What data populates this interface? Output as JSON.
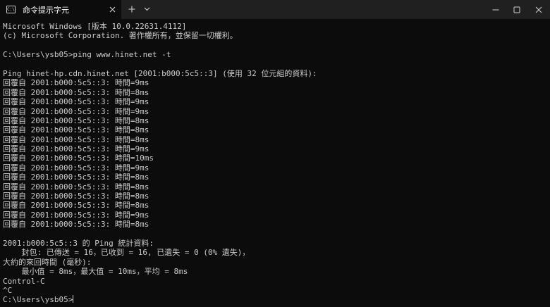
{
  "tab": {
    "title": "命令提示字元",
    "icon": "terminal-icon",
    "icon_glyph": "C:\\"
  },
  "titlebar_icons": {
    "close_tab": "close-icon",
    "new_tab": "plus-icon",
    "dropdown": "chevron-down-icon",
    "minimize": "minimize-icon",
    "maximize": "maximize-icon",
    "close_window": "close-icon"
  },
  "terminal": {
    "lines": [
      "Microsoft Windows [版本 10.0.22631.4112]",
      "(c) Microsoft Corporation. 著作權所有，並保留一切權利。",
      "",
      "C:\\Users\\ysb05>ping www.hinet.net -t",
      "",
      "Ping hinet-hp.cdn.hinet.net [2001:b000:5c5::3] (使用 32 位元組的資料):",
      "回覆自 2001:b000:5c5::3: 時間=9ms",
      "回覆自 2001:b000:5c5::3: 時間=8ms",
      "回覆自 2001:b000:5c5::3: 時間=9ms",
      "回覆自 2001:b000:5c5::3: 時間=9ms",
      "回覆自 2001:b000:5c5::3: 時間=8ms",
      "回覆自 2001:b000:5c5::3: 時間=8ms",
      "回覆自 2001:b000:5c5::3: 時間=8ms",
      "回覆自 2001:b000:5c5::3: 時間=9ms",
      "回覆自 2001:b000:5c5::3: 時間=10ms",
      "回覆自 2001:b000:5c5::3: 時間=9ms",
      "回覆自 2001:b000:5c5::3: 時間=8ms",
      "回覆自 2001:b000:5c5::3: 時間=8ms",
      "回覆自 2001:b000:5c5::3: 時間=8ms",
      "回覆自 2001:b000:5c5::3: 時間=8ms",
      "回覆自 2001:b000:5c5::3: 時間=9ms",
      "回覆自 2001:b000:5c5::3: 時間=8ms",
      "",
      "2001:b000:5c5::3 的 Ping 統計資料:",
      "    封包: 已傳送 = 16，已收到 = 16, 已遺失 = 0 (0% 遺失)，",
      "大約的來回時間 (毫秒):",
      "    最小值 = 8ms，最大值 = 10ms，平均 = 8ms",
      "Control-C",
      "^C"
    ],
    "prompt": "C:\\Users\\ysb05>"
  },
  "colors": {
    "background": "#0c0c0c",
    "titlebar": "#202020",
    "text": "#cccccc"
  }
}
